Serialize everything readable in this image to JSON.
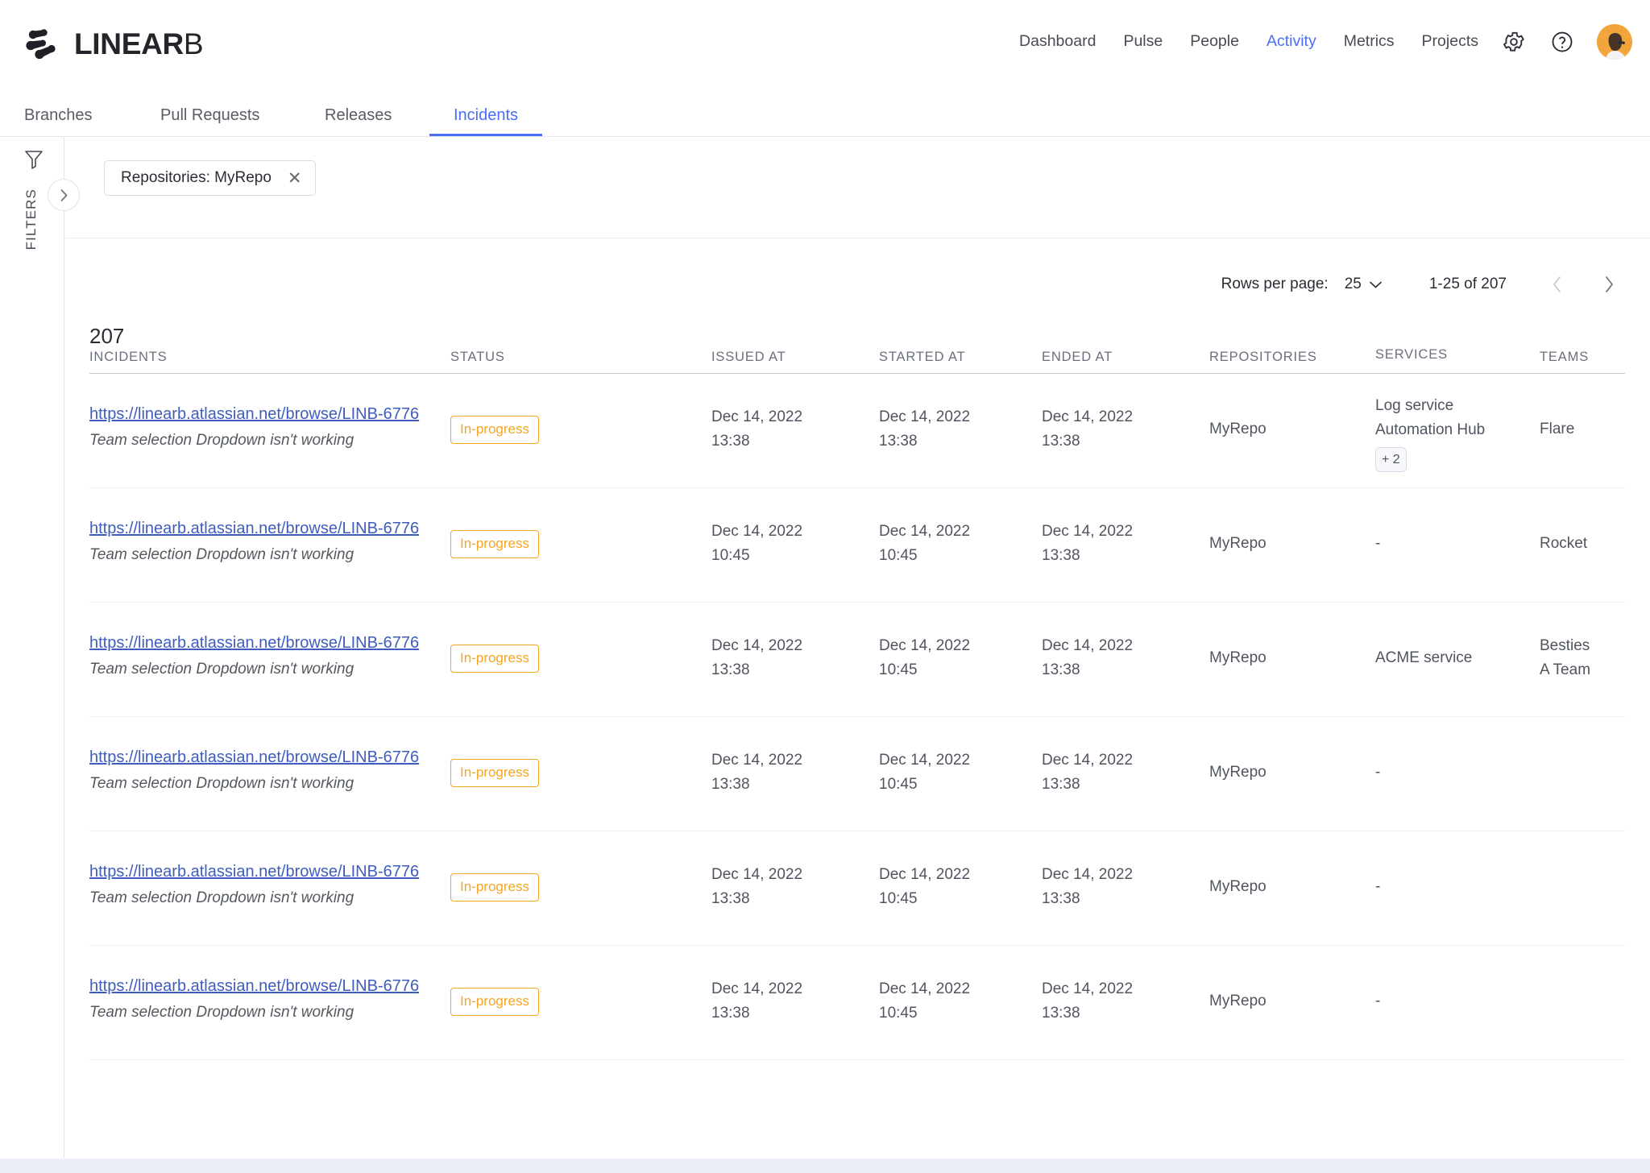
{
  "brand": {
    "name_bold": "LINEAR",
    "name_thin": "B",
    "logo_icon": "linearb-logo-icon",
    "accent": "#4a6ef5"
  },
  "topnav": {
    "items": [
      {
        "label": "Dashboard",
        "active": false
      },
      {
        "label": "Pulse",
        "active": false
      },
      {
        "label": "People",
        "active": false
      },
      {
        "label": "Activity",
        "active": true
      },
      {
        "label": "Metrics",
        "active": false
      },
      {
        "label": "Projects",
        "active": false
      }
    ],
    "icons": [
      {
        "name": "gear-icon",
        "glyph": "settings"
      },
      {
        "name": "help-icon",
        "glyph": "question-circle"
      },
      {
        "name": "avatar",
        "glyph": "user-photo"
      }
    ]
  },
  "subtabs": [
    {
      "label": "Branches",
      "active": false
    },
    {
      "label": "Pull Requests",
      "active": false
    },
    {
      "label": "Releases",
      "active": false
    },
    {
      "label": "Incidents",
      "active": true
    }
  ],
  "filters": {
    "rail_label": "FILTERS",
    "funnel_icon": "filter-funnel-icon",
    "expand_icon": "chevron-right-icon",
    "chips": [
      {
        "label": "Repositories: MyRepo",
        "remove_icon": "close-icon"
      }
    ]
  },
  "pagination": {
    "rows_label": "Rows per page:",
    "rows_value": "25",
    "range": "1-25 of 207",
    "prev_icon": "chevron-left-icon",
    "next_icon": "chevron-right-icon"
  },
  "table": {
    "total_count": "207",
    "headers": {
      "incidents": "INCIDENTS",
      "status": "STATUS",
      "issued_at": "ISSUED AT",
      "started_at": "STARTED AT",
      "ended_at": "ENDED AT",
      "repositories": "REPOSITORIES",
      "services": "SERVICES",
      "teams": "TEAMS"
    },
    "status_color": "#f5a623",
    "link_color": "#3f5dbd",
    "rows": [
      {
        "link": "https://linearb.atlassian.net/browse/LINB-6776",
        "subtitle": "Team selection Dropdown isn't working",
        "status": "In-progress",
        "issued_date": "Dec 14, 2022",
        "issued_time": "13:38",
        "started_date": "Dec 14, 2022",
        "started_time": "13:38",
        "ended_date": "Dec 14, 2022",
        "ended_time": "13:38",
        "repository": "MyRepo",
        "services": [
          "Log service",
          "Automation Hub"
        ],
        "services_more": "+ 2",
        "teams": [
          "Flare"
        ]
      },
      {
        "link": "https://linearb.atlassian.net/browse/LINB-6776",
        "subtitle": "Team selection Dropdown isn't working",
        "status": "In-progress",
        "issued_date": "Dec 14, 2022",
        "issued_time": "10:45",
        "started_date": "Dec 14, 2022",
        "started_time": "10:45",
        "ended_date": "Dec 14, 2022",
        "ended_time": "13:38",
        "repository": "MyRepo",
        "services": [
          "-"
        ],
        "services_more": "",
        "teams": [
          "Rocket"
        ]
      },
      {
        "link": "https://linearb.atlassian.net/browse/LINB-6776",
        "subtitle": "Team selection Dropdown isn't working",
        "status": "In-progress",
        "issued_date": "Dec 14, 2022",
        "issued_time": "13:38",
        "started_date": "Dec 14, 2022",
        "started_time": "10:45",
        "ended_date": "Dec 14, 2022",
        "ended_time": "13:38",
        "repository": "MyRepo",
        "services": [
          "ACME service"
        ],
        "services_more": "",
        "teams": [
          "Besties",
          "A Team"
        ]
      },
      {
        "link": "https://linearb.atlassian.net/browse/LINB-6776",
        "subtitle": "Team selection Dropdown isn't working",
        "status": "In-progress",
        "issued_date": "Dec 14, 2022",
        "issued_time": "13:38",
        "started_date": "Dec 14, 2022",
        "started_time": "10:45",
        "ended_date": "Dec 14, 2022",
        "ended_time": "13:38",
        "repository": "MyRepo",
        "services": [
          "-"
        ],
        "services_more": "",
        "teams": []
      },
      {
        "link": "https://linearb.atlassian.net/browse/LINB-6776",
        "subtitle": "Team selection Dropdown isn't working",
        "status": "In-progress",
        "issued_date": "Dec 14, 2022",
        "issued_time": "13:38",
        "started_date": "Dec 14, 2022",
        "started_time": "10:45",
        "ended_date": "Dec 14, 2022",
        "ended_time": "13:38",
        "repository": "MyRepo",
        "services": [
          "-"
        ],
        "services_more": "",
        "teams": []
      },
      {
        "link": "https://linearb.atlassian.net/browse/LINB-6776",
        "subtitle": "Team selection Dropdown isn't working",
        "status": "In-progress",
        "issued_date": "Dec 14, 2022",
        "issued_time": "13:38",
        "started_date": "Dec 14, 2022",
        "started_time": "10:45",
        "ended_date": "Dec 14, 2022",
        "ended_time": "13:38",
        "repository": "MyRepo",
        "services": [
          "-"
        ],
        "services_more": "",
        "teams": []
      }
    ]
  }
}
